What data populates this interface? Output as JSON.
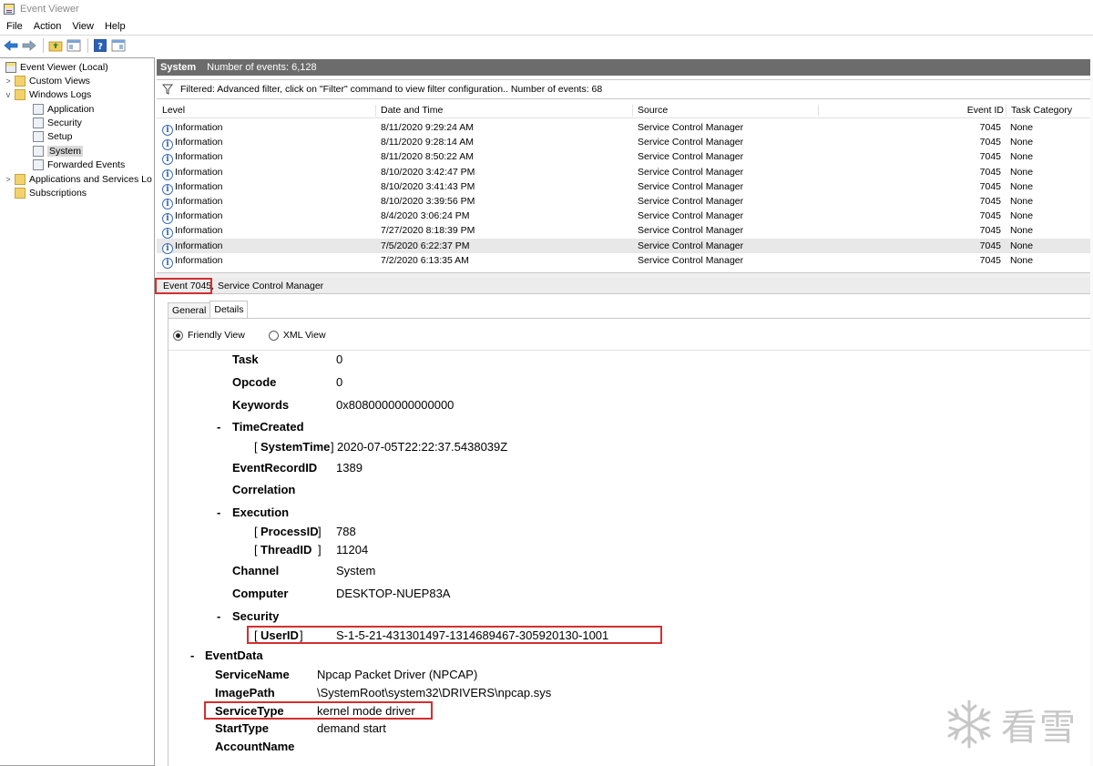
{
  "window": {
    "title": "Event Viewer"
  },
  "menu": [
    "File",
    "Action",
    "View",
    "Help"
  ],
  "toolbar": {
    "icons": [
      "back-arrow-icon",
      "forward-arrow-icon",
      "folder-up-icon",
      "show-hide-tree-icon",
      "help-icon",
      "properties-icon"
    ]
  },
  "nav": {
    "items": [
      {
        "label": "Event Viewer (Local)",
        "level": 0,
        "twisty": "",
        "icon": "event-viewer-icon"
      },
      {
        "label": "Custom Views",
        "level": 1,
        "twisty": ">",
        "icon": "folder-icon"
      },
      {
        "label": "Windows Logs",
        "level": 1,
        "twisty": "v",
        "icon": "folder-icon"
      },
      {
        "label": "Application",
        "level": 2,
        "twisty": "",
        "icon": "log-icon"
      },
      {
        "label": "Security",
        "level": 2,
        "twisty": "",
        "icon": "log-icon"
      },
      {
        "label": "Setup",
        "level": 2,
        "twisty": "",
        "icon": "log-icon"
      },
      {
        "label": "System",
        "level": 2,
        "twisty": "",
        "icon": "log-icon",
        "selected": true
      },
      {
        "label": "Forwarded Events",
        "level": 2,
        "twisty": "",
        "icon": "log-icon"
      },
      {
        "label": "Applications and Services Lo",
        "level": 1,
        "twisty": ">",
        "icon": "folder-icon"
      },
      {
        "label": "Subscriptions",
        "level": 1,
        "twisty": "",
        "icon": "subscriptions-icon"
      }
    ]
  },
  "pane": {
    "title": "System",
    "count": "Number of events: 6,128",
    "filter": "Filtered: Advanced filter, click on \"Filter\" command to view filter configuration.. Number of events: 68"
  },
  "grid": {
    "columns": [
      "Level",
      "Date and Time",
      "Source",
      "Event ID",
      "Task Category"
    ],
    "rows": [
      [
        "Information",
        "8/11/2020 9:29:24 AM",
        "Service Control Manager",
        "7045",
        "None"
      ],
      [
        "Information",
        "8/11/2020 9:28:14 AM",
        "Service Control Manager",
        "7045",
        "None"
      ],
      [
        "Information",
        "8/11/2020 8:50:22 AM",
        "Service Control Manager",
        "7045",
        "None"
      ],
      [
        "Information",
        "8/10/2020 3:42:47 PM",
        "Service Control Manager",
        "7045",
        "None"
      ],
      [
        "Information",
        "8/10/2020 3:41:43 PM",
        "Service Control Manager",
        "7045",
        "None"
      ],
      [
        "Information",
        "8/10/2020 3:39:56 PM",
        "Service Control Manager",
        "7045",
        "None"
      ],
      [
        "Information",
        "8/4/2020 3:06:24 PM",
        "Service Control Manager",
        "7045",
        "None"
      ],
      [
        "Information",
        "7/27/2020 8:18:39 PM",
        "Service Control Manager",
        "7045",
        "None"
      ],
      [
        "Information",
        "7/5/2020 6:22:37 PM",
        "Service Control Manager",
        "7045",
        "None"
      ],
      [
        "Information",
        "7/2/2020 6:13:35 AM",
        "Service Control Manager",
        "7045",
        "None"
      ]
    ],
    "selected_row": 8
  },
  "detail": {
    "event_id": "Event 7045,",
    "source": "Service Control Manager",
    "tabs": [
      "General",
      "Details"
    ],
    "views": [
      "Friendly View",
      "XML View"
    ],
    "fields": {
      "task_k": "Task",
      "task_v": "0",
      "opcode_k": "Opcode",
      "opcode_v": "0",
      "keywords_k": "Keywords",
      "keywords_v": "0x8080000000000000",
      "timecreated_k": "TimeCreated",
      "systemtime_k": "SystemTime",
      "systemtime_v": "2020-07-05T22:22:37.5438039Z",
      "recordid_k": "EventRecordID",
      "recordid_v": "1389",
      "correlation_k": "Correlation",
      "execution_k": "Execution",
      "processid_k": "ProcessID",
      "processid_v": "788",
      "threadid_k": "ThreadID",
      "threadid_v": "11204",
      "channel_k": "Channel",
      "channel_v": "System",
      "computer_k": "Computer",
      "computer_v": "DESKTOP-NUEP83A",
      "security_k": "Security",
      "userid_k": "UserID",
      "userid_v": "S-1-5-21-431301497-1314689467-305920130-1001",
      "eventdata_k": "EventData",
      "servicename_k": "ServiceName",
      "servicename_v": "Npcap Packet Driver (NPCAP)",
      "imagepath_k": "ImagePath",
      "imagepath_v": "\\SystemRoot\\system32\\DRIVERS\\npcap.sys",
      "servicetype_k": "ServiceType",
      "servicetype_v": "kernel mode driver",
      "starttype_k": "StartType",
      "starttype_v": "demand start",
      "accountname_k": "AccountName",
      "minus": "-",
      "lb": "[",
      "rb": "]"
    }
  },
  "watermark": {
    "text": "看雪"
  },
  "colors": {
    "highlight": "#d32f2f",
    "header_bar": "#6c6c6c",
    "selection": "#e8e8e8"
  }
}
